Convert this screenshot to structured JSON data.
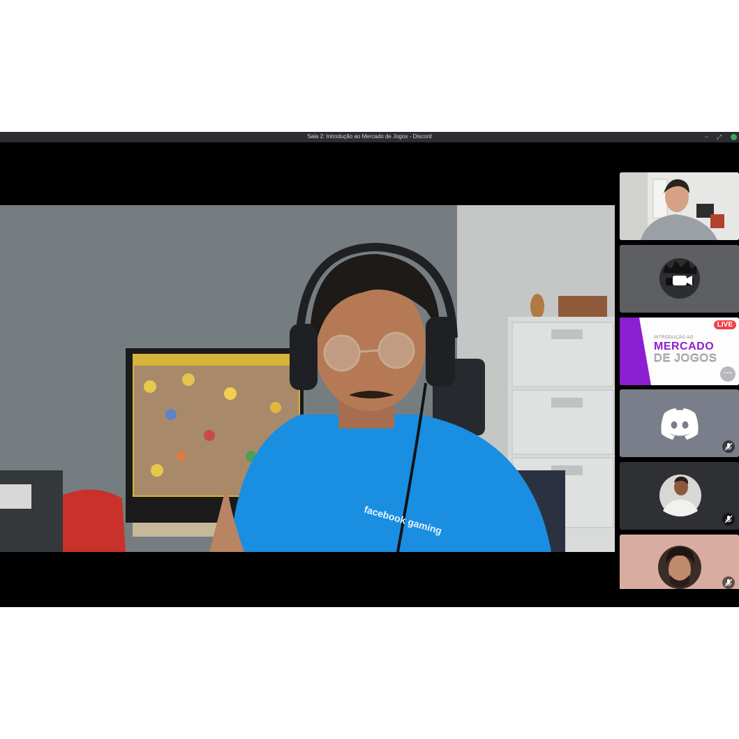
{
  "window": {
    "title": "Sala 2: Introdução ao Mercado de Jogos - Discord",
    "controls": {
      "minimize": "−",
      "maximize": "⤢"
    }
  },
  "main_stream": {
    "participant": "presenter",
    "shirt_text": "facebook gaming"
  },
  "participants": [
    {
      "type": "camera",
      "muted": false
    },
    {
      "type": "avatar",
      "icon": "glasses-avatar-icon",
      "muted": false
    },
    {
      "type": "stream",
      "live_badge": "LIVE",
      "banner_small": "INTRODUÇÃO AO",
      "banner_line1": "MERCADO",
      "banner_line2": "DE JOGOS",
      "more_button": "···"
    },
    {
      "type": "avatar",
      "icon": "discord-logo-icon",
      "muted": true
    },
    {
      "type": "avatar",
      "icon": "user-photo-icon",
      "muted": true
    },
    {
      "type": "avatar",
      "icon": "user-photo-icon",
      "muted": true
    }
  ],
  "colors": {
    "titlebar": "#2b2d31",
    "tile_gray": "#5e5f62",
    "discord_blurple": "#7a7e8a",
    "live_red": "#ed4245",
    "banner_purple": "#8b1fd1",
    "shirt_blue": "#1a8ee0"
  }
}
